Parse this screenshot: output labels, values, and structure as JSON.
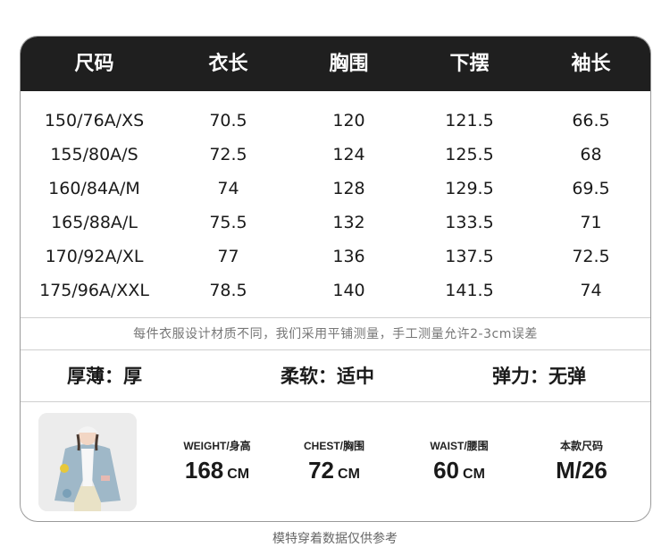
{
  "table": {
    "headers": [
      "尺码",
      "衣长",
      "胸围",
      "下摆",
      "袖长"
    ],
    "rows": [
      [
        "150/76A/XS",
        "70.5",
        "120",
        "121.5",
        "66.5"
      ],
      [
        "155/80A/S",
        "72.5",
        "124",
        "125.5",
        "68"
      ],
      [
        "160/84A/M",
        "74",
        "128",
        "129.5",
        "69.5"
      ],
      [
        "165/88A/L",
        "75.5",
        "132",
        "133.5",
        "71"
      ],
      [
        "170/92A/XL",
        "77",
        "136",
        "137.5",
        "72.5"
      ],
      [
        "175/96A/XXL",
        "78.5",
        "140",
        "141.5",
        "74"
      ]
    ]
  },
  "note": "每件衣服设计材质不同，我们采用平铺测量，手工测量允许2-3cm误差",
  "properties": [
    {
      "label": "厚薄：",
      "value": "厚"
    },
    {
      "label": "柔软：",
      "value": "适中"
    },
    {
      "label": "弹力：",
      "value": "无弹"
    }
  ],
  "model": {
    "weight_label": "WEIGHT/身高",
    "weight_value": "168",
    "weight_unit": "CM",
    "chest_label": "CHEST/胸围",
    "chest_value": "72",
    "chest_unit": "CM",
    "waist_label": "WAIST/腰围",
    "waist_value": "60",
    "waist_unit": "CM",
    "size_label": "本款尺码",
    "size_value": "M/26"
  },
  "footer": "模特穿着数据仅供参考",
  "colors": {
    "header_bg": "#1f1f1f",
    "border": "#9a9a9a",
    "note_text": "#777777"
  }
}
